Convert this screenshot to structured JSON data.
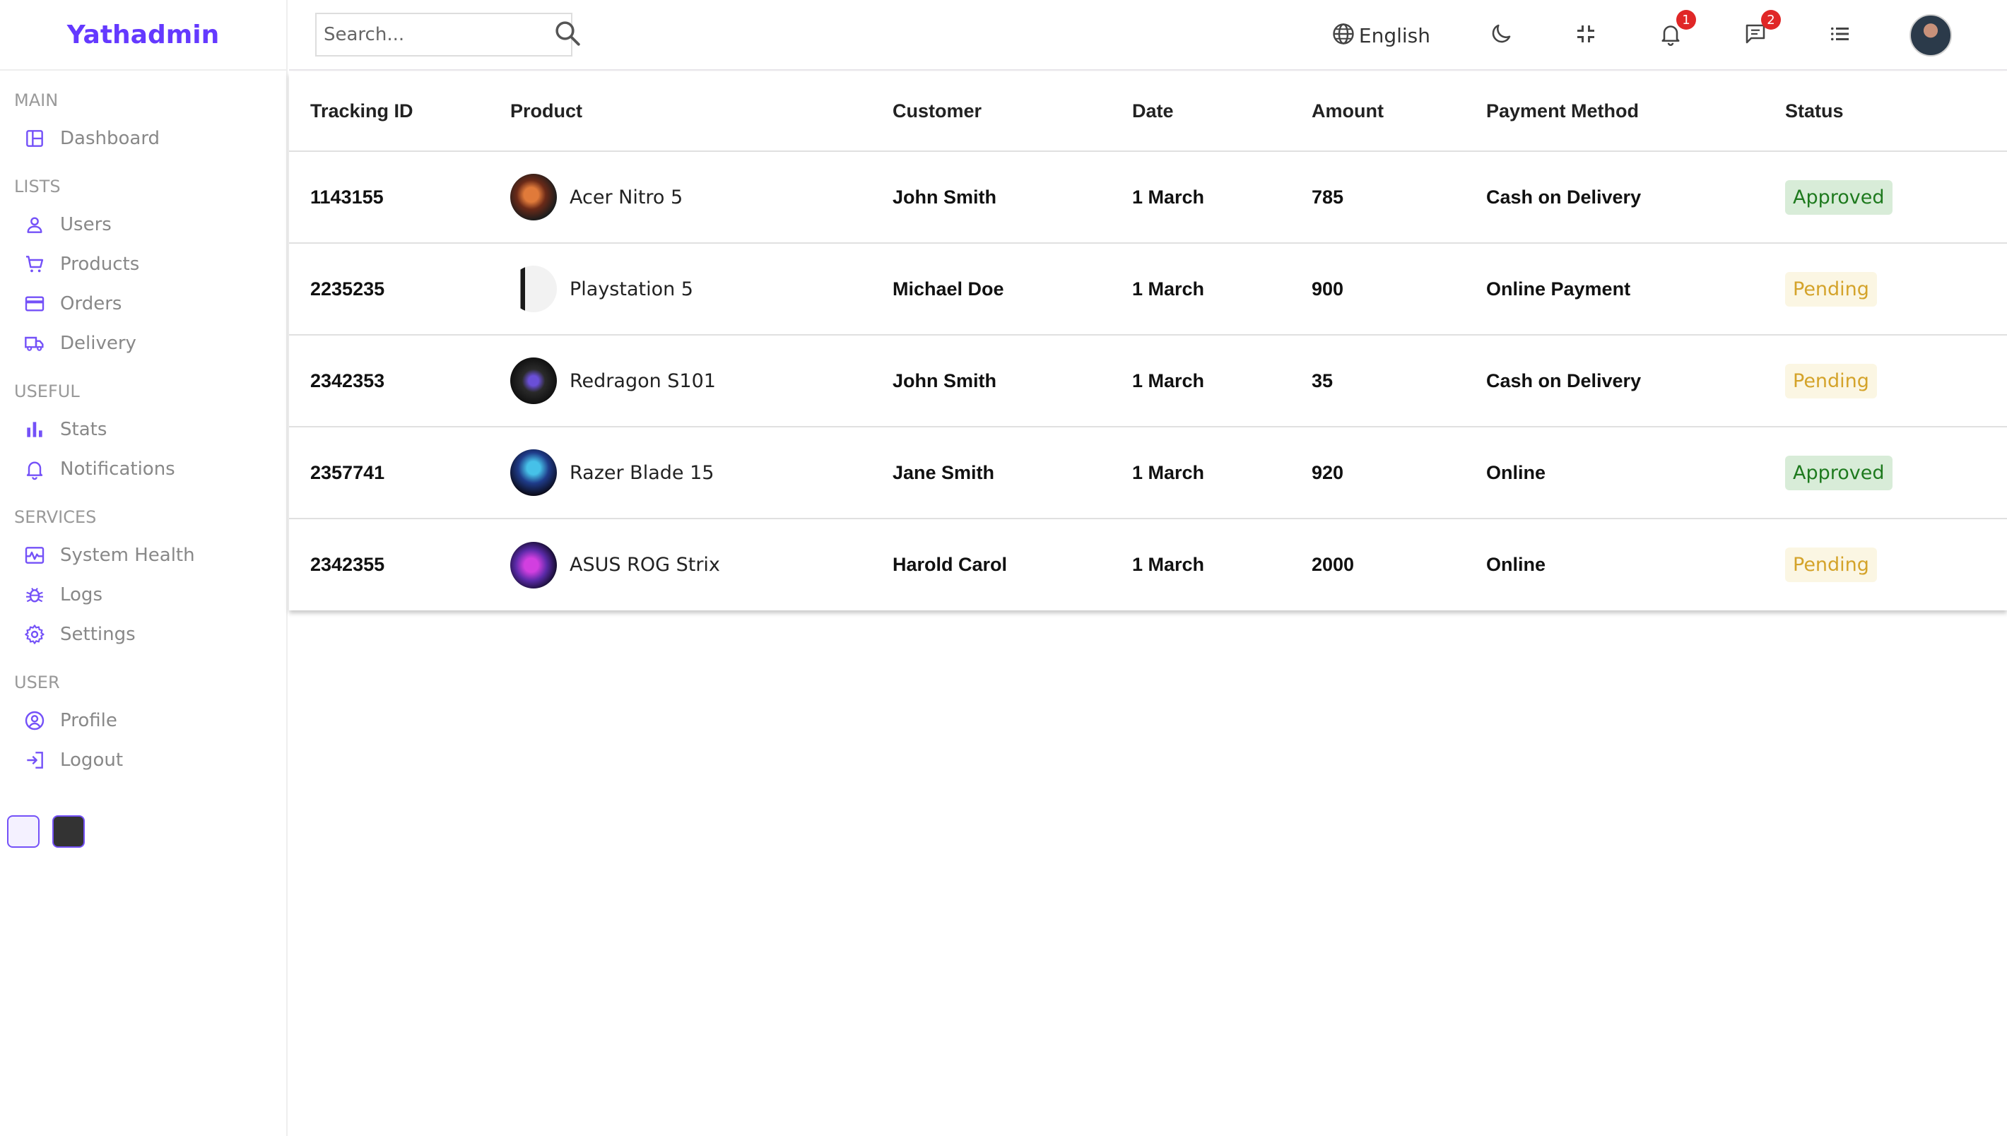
{
  "app": {
    "logo": "Yathadmin"
  },
  "sidebar": {
    "sections": [
      {
        "title": "MAIN",
        "items": [
          {
            "label": "Dashboard",
            "icon": "dashboard-icon"
          }
        ]
      },
      {
        "title": "LISTS",
        "items": [
          {
            "label": "Users",
            "icon": "user-icon"
          },
          {
            "label": "Products",
            "icon": "cart-icon"
          },
          {
            "label": "Orders",
            "icon": "credit-card-icon"
          },
          {
            "label": "Delivery",
            "icon": "truck-icon"
          }
        ]
      },
      {
        "title": "USEFUL",
        "items": [
          {
            "label": "Stats",
            "icon": "bar-chart-icon"
          },
          {
            "label": "Notifications",
            "icon": "bell-icon"
          }
        ]
      },
      {
        "title": "SERVICES",
        "items": [
          {
            "label": "System Health",
            "icon": "health-icon"
          },
          {
            "label": "Logs",
            "icon": "bug-icon"
          },
          {
            "label": "Settings",
            "icon": "gear-icon"
          }
        ]
      },
      {
        "title": "USER",
        "items": [
          {
            "label": "Profile",
            "icon": "profile-icon"
          },
          {
            "label": "Logout",
            "icon": "logout-icon"
          }
        ]
      }
    ],
    "color_options": [
      "#f4f1ff",
      "#333333"
    ]
  },
  "topbar": {
    "search_placeholder": "Search...",
    "language": "English",
    "notifications_count": "1",
    "messages_count": "2"
  },
  "table": {
    "headers": [
      "Tracking ID",
      "Product",
      "Customer",
      "Date",
      "Amount",
      "Payment Method",
      "Status"
    ],
    "rows": [
      {
        "id": "1143155",
        "product": "Acer Nitro 5",
        "customer": "John Smith",
        "date": "1 March",
        "amount": "785",
        "method": "Cash on Delivery",
        "status": "Approved"
      },
      {
        "id": "2235235",
        "product": "Playstation 5",
        "customer": "Michael Doe",
        "date": "1 March",
        "amount": "900",
        "method": "Online Payment",
        "status": "Pending"
      },
      {
        "id": "2342353",
        "product": "Redragon S101",
        "customer": "John Smith",
        "date": "1 March",
        "amount": "35",
        "method": "Cash on Delivery",
        "status": "Pending"
      },
      {
        "id": "2357741",
        "product": "Razer Blade 15",
        "customer": "Jane Smith",
        "date": "1 March",
        "amount": "920",
        "method": "Online",
        "status": "Approved"
      },
      {
        "id": "2342355",
        "product": "ASUS ROG Strix",
        "customer": "Harold Carol",
        "date": "1 March",
        "amount": "2000",
        "method": "Online",
        "status": "Pending"
      }
    ]
  },
  "colors": {
    "accent": "#6439ff",
    "icon": "#7451f8",
    "approved_bg": "#d8ecd8",
    "approved_fg": "#1e7a1e",
    "pending_bg": "#fbf6e3",
    "pending_fg": "#d4a32a"
  }
}
